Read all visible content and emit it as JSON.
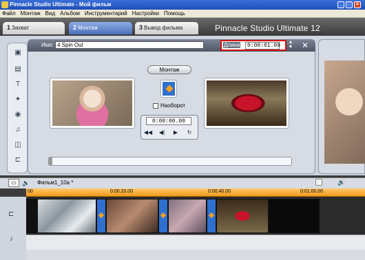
{
  "window": {
    "title": "Pinnacle Studio Ultimate - Мой фильм"
  },
  "menu": [
    "Файл",
    "Монтаж",
    "Вид",
    "Альбом",
    "Инструментарий",
    "Настройки",
    "Помощь"
  ],
  "tabs": [
    {
      "num": "1",
      "label": "Захват"
    },
    {
      "num": "2",
      "label": "Монтаж",
      "active": true
    },
    {
      "num": "3",
      "label": "Вывод фильма"
    }
  ],
  "brand": "Pinnacle Studio Ultimate 12",
  "editor": {
    "name_label": "Имя:",
    "name_value": "4 Spin Out",
    "duration_label": "Длина",
    "duration_value": "0:00:01.09",
    "mode_button": "Монтаж",
    "reverse_label": "Наоборот",
    "reverse_checked": false,
    "timecode": "0:00:00.00",
    "close_label": "✕"
  },
  "timeline": {
    "film_label": "Фильм1_10a *",
    "ruler_labels": [
      "0:00:20.00",
      "0:00:40.00",
      "0:01:00.00"
    ],
    "ruler_start": "00"
  },
  "colors": {
    "accent": "#2f6fd0",
    "highlight": "#d01010",
    "ruler": "#f09a1c"
  },
  "icons": {
    "transport": [
      "skip-start-icon",
      "step-back-icon",
      "play-icon",
      "loop-icon"
    ],
    "tools": [
      "video-toolbox-icon",
      "title-icon",
      "text-icon",
      "effects-icon",
      "audio-icon",
      "music-icon",
      "frame-icon",
      "split-icon"
    ]
  }
}
